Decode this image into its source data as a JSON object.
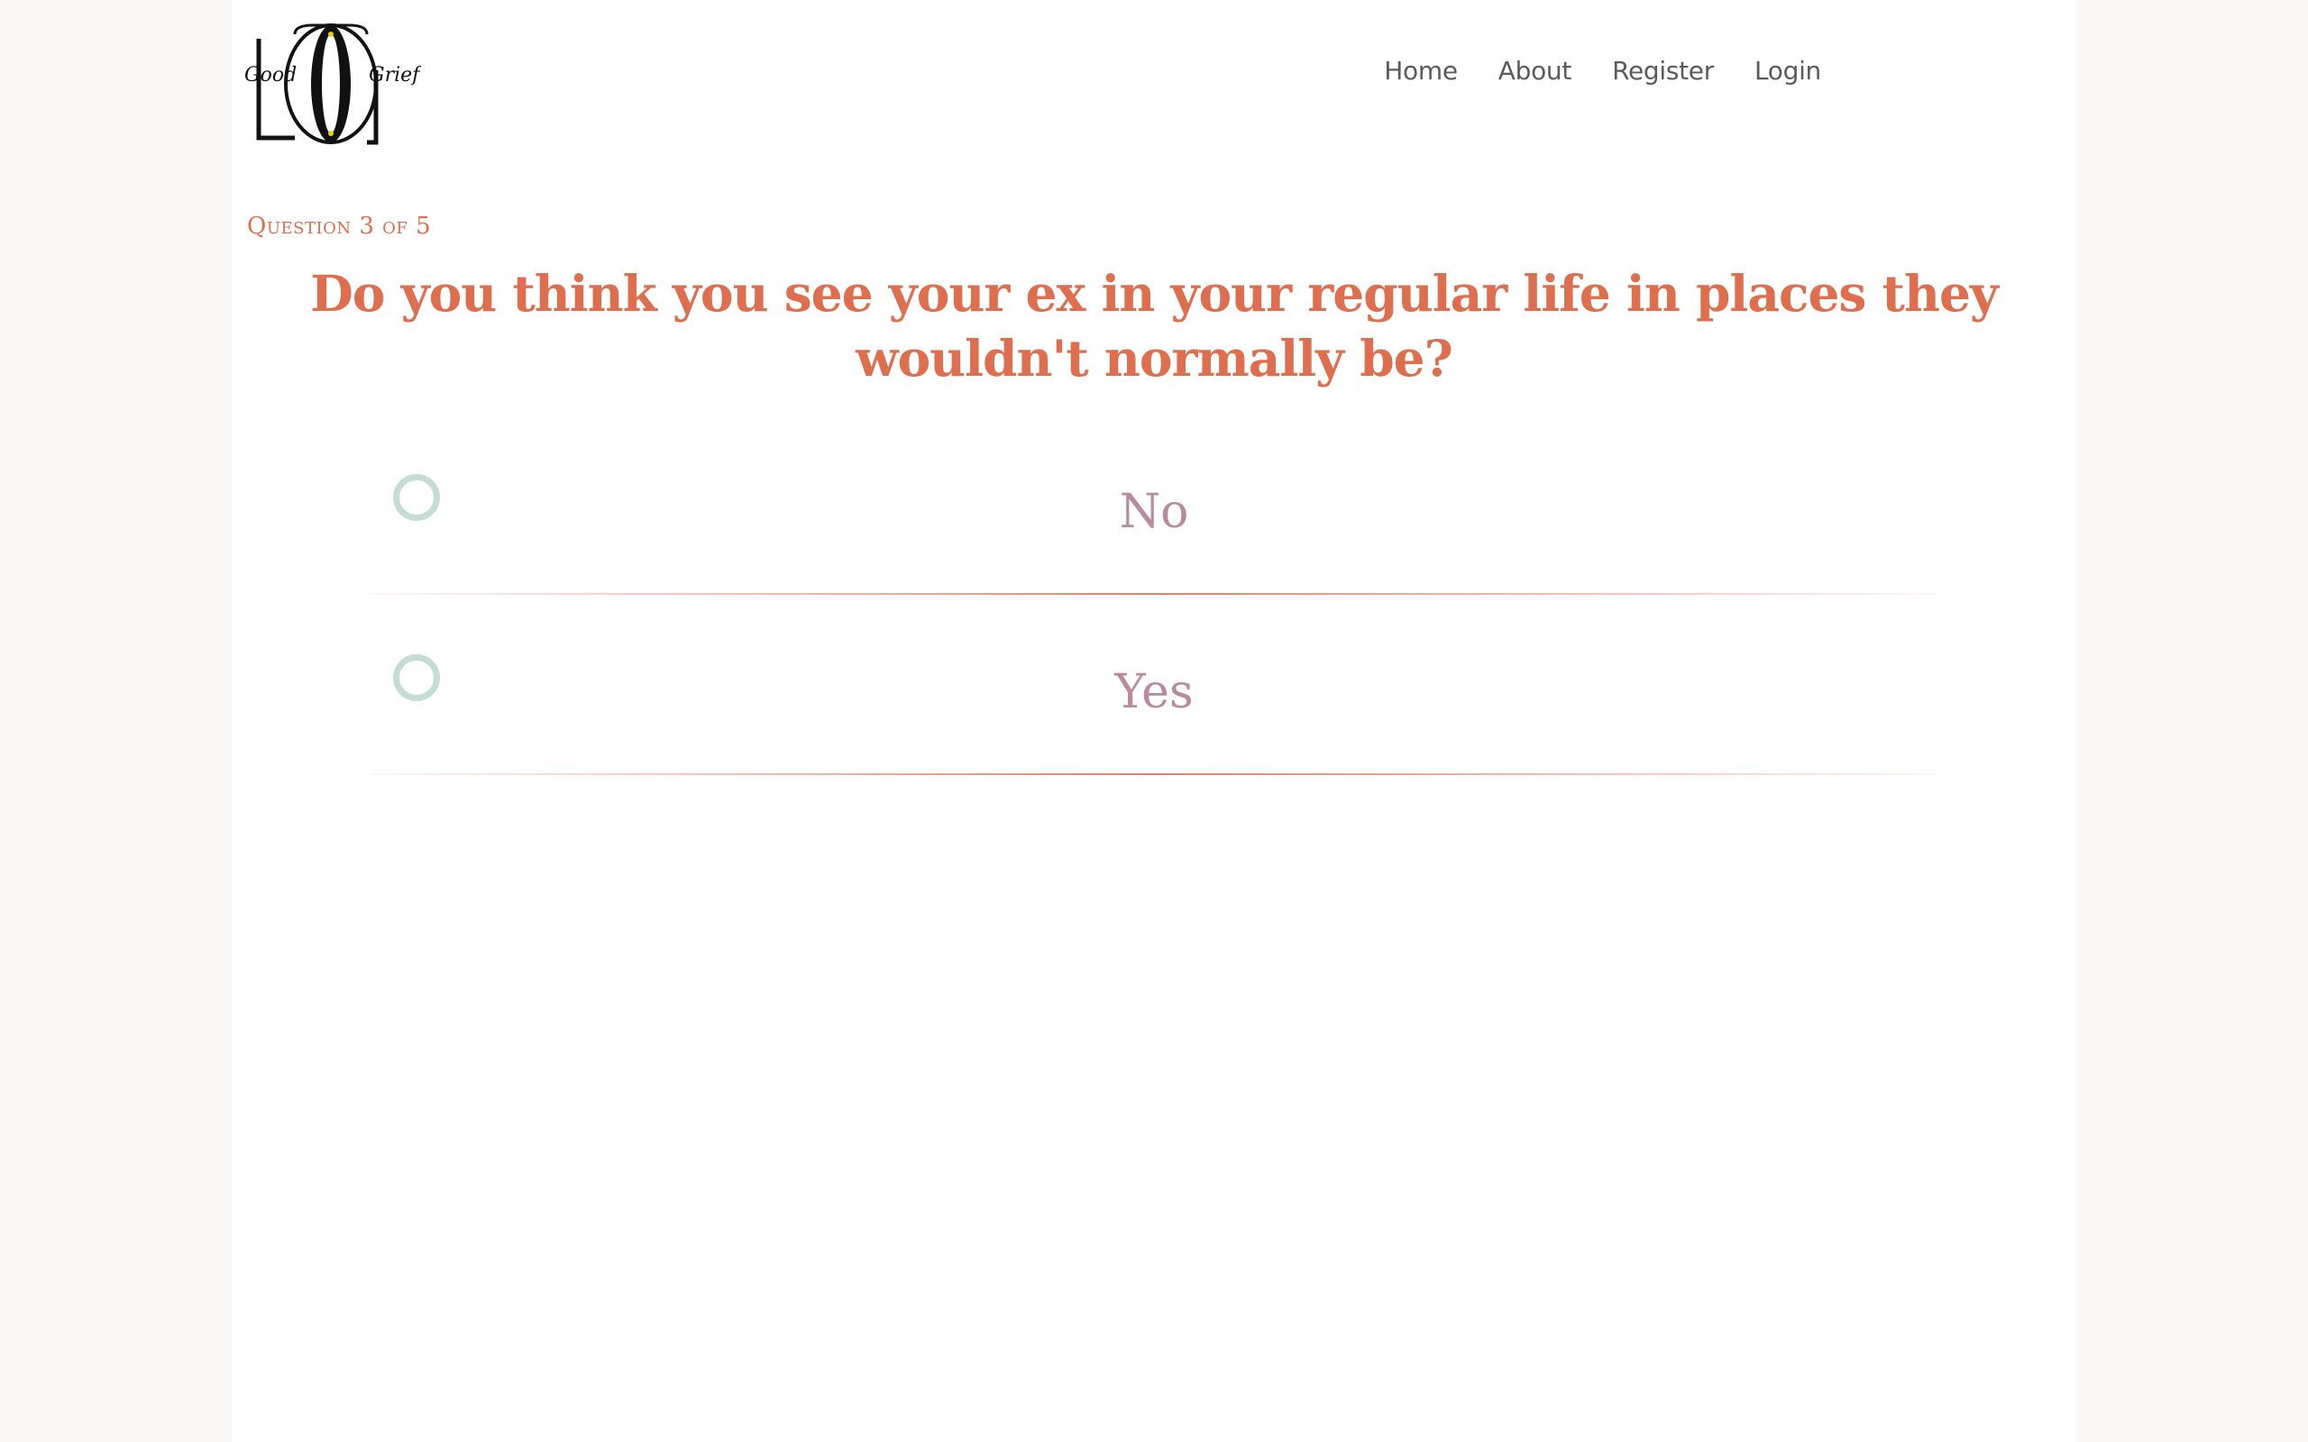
{
  "brand": {
    "logo_word_left": "Good",
    "logo_word_right": "Grief"
  },
  "nav": {
    "items": [
      {
        "label": "Home"
      },
      {
        "label": "About"
      },
      {
        "label": "Register"
      },
      {
        "label": "Login"
      }
    ]
  },
  "quiz": {
    "progress": "Question 3 of 5",
    "question": "Do you think you see your ex in your regular life in places they wouldn't normally be?",
    "answers": [
      {
        "label": "No"
      },
      {
        "label": "Yes"
      }
    ]
  },
  "colors": {
    "accent": "#de6f4e",
    "answer_text": "#b88a9c",
    "radio_ring": "#c3ddd5",
    "page_background": "#faf7f4",
    "nav_text": "#5a5a5a"
  }
}
